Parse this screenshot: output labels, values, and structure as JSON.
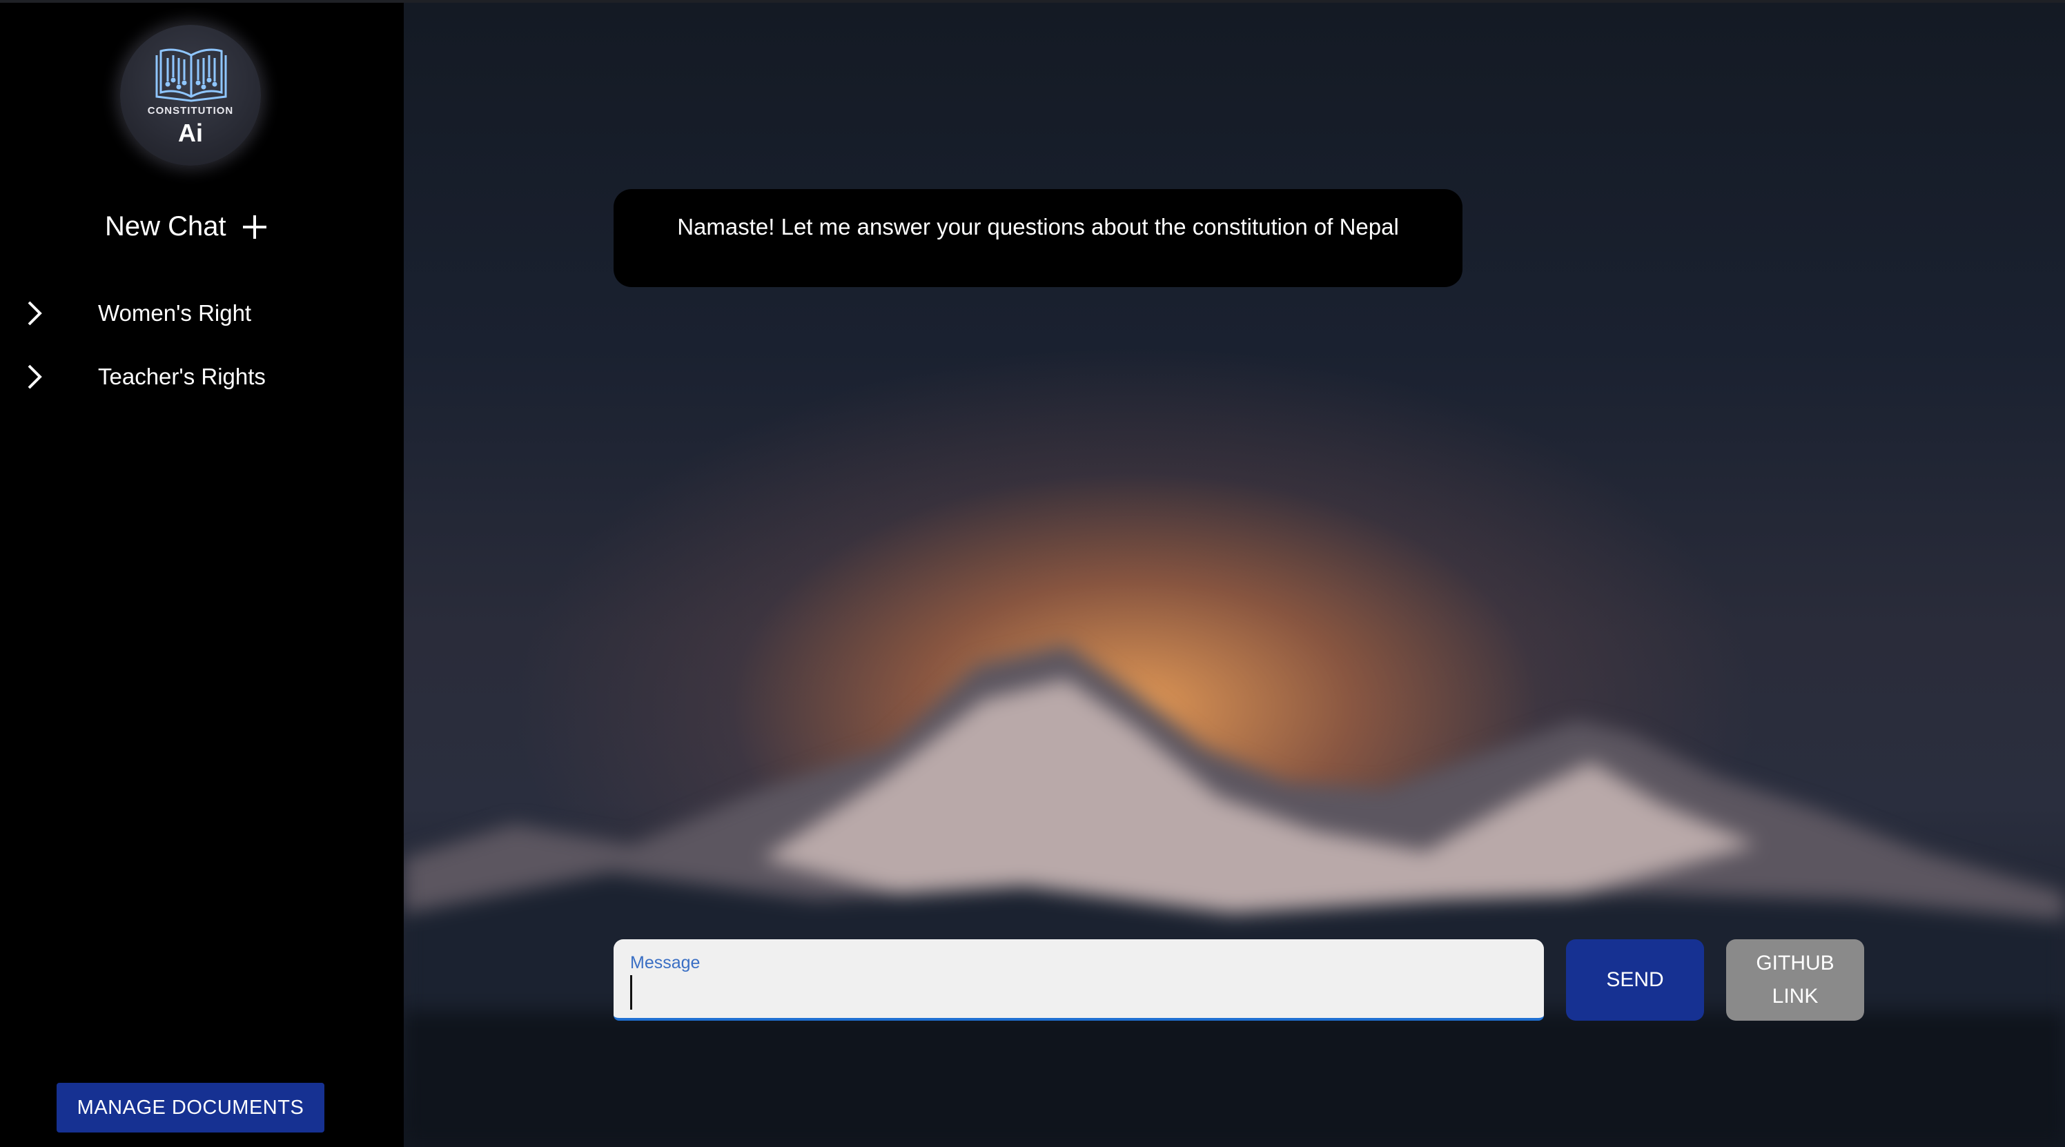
{
  "brand": {
    "logo_word": "CONSTITUTION",
    "logo_ai": "Ai"
  },
  "sidebar": {
    "new_chat_label": "New Chat",
    "items": [
      {
        "label": "Women's Right"
      },
      {
        "label": "Teacher's Rights"
      }
    ],
    "manage_documents_label": "MANAGE DOCUMENTS"
  },
  "chat": {
    "welcome_message": "Namaste! Let me answer your questions about the constitution of Nepal"
  },
  "composer": {
    "message_label": "Message",
    "message_value": "",
    "send_label": "SEND",
    "github_label": "GITHUB\nLINK"
  },
  "colors": {
    "primary_button": "#163192",
    "secondary_button": "#8a8a8a",
    "input_focus": "#1f6fd1",
    "sidebar_bg": "#000000"
  }
}
